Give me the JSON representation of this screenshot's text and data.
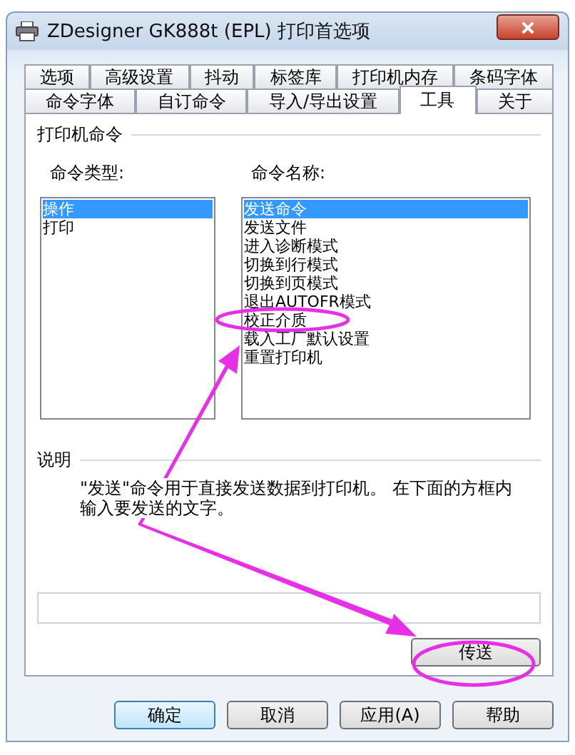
{
  "window": {
    "title": "ZDesigner GK888t (EPL) 打印首选项"
  },
  "tab_rows": [
    [
      {
        "label": "选项",
        "selected": false
      },
      {
        "label": "高级设置",
        "selected": false
      },
      {
        "label": "抖动",
        "selected": false
      },
      {
        "label": "标签库",
        "selected": false
      },
      {
        "label": "打印机内存",
        "selected": false
      },
      {
        "label": "条码字体",
        "selected": false
      }
    ],
    [
      {
        "label": "命令字体",
        "selected": false
      },
      {
        "label": "自订命令",
        "selected": false
      },
      {
        "label": "导入/导出设置",
        "selected": false
      },
      {
        "label": "工具",
        "selected": true
      },
      {
        "label": "关于",
        "selected": false
      }
    ]
  ],
  "group_label": "打印机命令",
  "command_types": {
    "label": "命令类型:",
    "items": [
      {
        "label": "操作",
        "selected": true
      },
      {
        "label": "打印",
        "selected": false
      }
    ]
  },
  "command_names": {
    "label": "命令名称:",
    "items": [
      {
        "label": "发送命令",
        "selected": true
      },
      {
        "label": "发送文件",
        "selected": false
      },
      {
        "label": "进入诊断模式",
        "selected": false
      },
      {
        "label": "切换到行模式",
        "selected": false
      },
      {
        "label": "切换到页模式",
        "selected": false
      },
      {
        "label": "退出AUTOFR模式",
        "selected": false
      },
      {
        "label": "校正介质",
        "selected": false
      },
      {
        "label": "载入工厂默认设置",
        "selected": false
      },
      {
        "label": "重置打印机",
        "selected": false
      }
    ]
  },
  "description": {
    "label": "说明",
    "text": "\"发送\"命令用于直接发送数据到打印机。 在下面的方框内输入要发送的文字。"
  },
  "send_button": "传送",
  "buttons": [
    {
      "label": "确定",
      "default": true
    },
    {
      "label": "取消",
      "default": false
    },
    {
      "label": "应用(A)",
      "default": false
    },
    {
      "label": "帮助",
      "default": false
    }
  ]
}
